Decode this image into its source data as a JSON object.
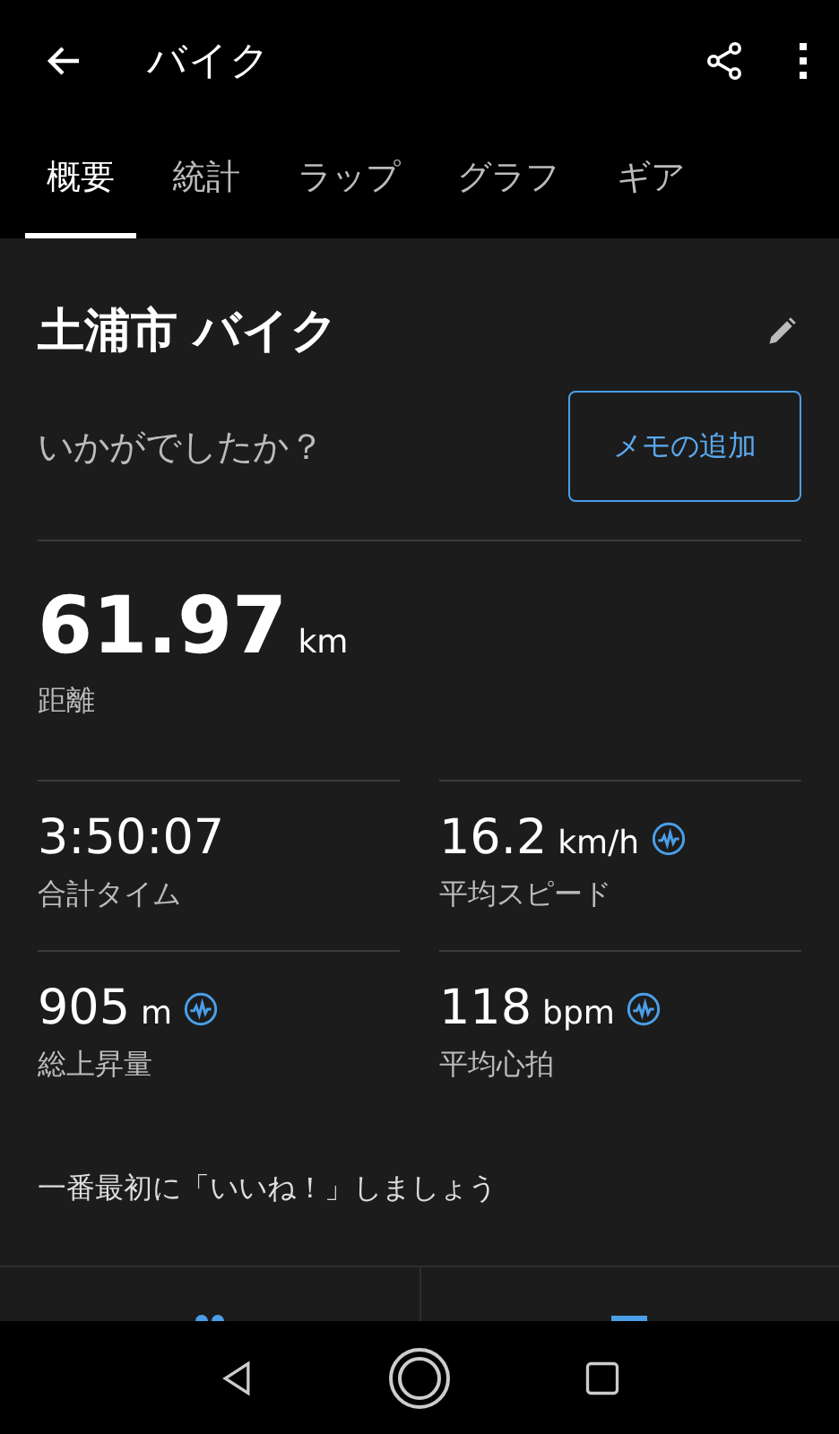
{
  "app_bar": {
    "title": "バイク"
  },
  "tabs": [
    {
      "label": "概要",
      "selected": true
    },
    {
      "label": "統計",
      "selected": false
    },
    {
      "label": "ラップ",
      "selected": false
    },
    {
      "label": "グラフ",
      "selected": false
    },
    {
      "label": "ギア",
      "selected": false
    }
  ],
  "activity": {
    "name": "土浦市 バイク",
    "prompt": "いかがでしたか？",
    "memo_button": "メモの追加"
  },
  "distance": {
    "value": "61.97",
    "unit": "km",
    "label": "距離"
  },
  "stats": [
    {
      "value": "3:50:07",
      "label": "合計タイム",
      "has_chart": false
    },
    {
      "value": "16.2",
      "unit": "km/h",
      "label": "平均スピード",
      "has_chart": true
    },
    {
      "value": "905",
      "unit": "m",
      "label": "総上昇量",
      "has_chart": true
    },
    {
      "value": "118",
      "unit": "bpm",
      "label": "平均心拍",
      "has_chart": true
    }
  ],
  "like_prompt": "一番最初に「いいね！」しましょう"
}
